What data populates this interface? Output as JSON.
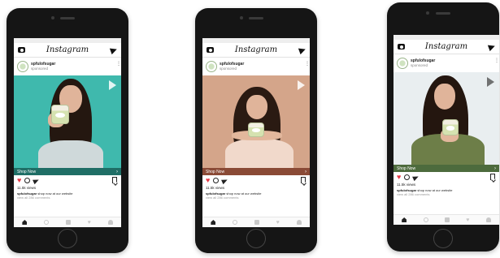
{
  "app": {
    "name": "Instagram"
  },
  "mockups": [
    {
      "user": "spfulofsugar",
      "sponsored": "sponsored",
      "cta": "Shop Now",
      "views": "11.5k views",
      "caption_user": "spfulofsugar",
      "caption_text": "shop now at our website",
      "view_comments": "view all 286 comments",
      "photo_bg": "#3fb9ad",
      "cta_bg": "#1f6e66"
    },
    {
      "user": "spfulofsugar",
      "sponsored": "sponsored",
      "cta": "Shop Now",
      "views": "11.5k views",
      "caption_user": "spfulofsugar",
      "caption_text": "shop now at our website",
      "view_comments": "view all 286 comments",
      "photo_bg": "#d4a58a",
      "cta_bg": "#8a4a36"
    },
    {
      "user": "spfulofsugar",
      "sponsored": "sponsored",
      "cta": "Shop Now",
      "views": "11.5k views",
      "caption_user": "spfulofsugar",
      "caption_text": "shop now at our website",
      "view_comments": "view all 286 comments",
      "photo_bg": "#e9eef0",
      "cta_bg": "#4d6b3d"
    }
  ],
  "icons": {
    "camera": "camera-icon",
    "send": "send-icon",
    "more": "more-icon",
    "play": "play-icon",
    "heart": "heart-icon",
    "comment": "comment-icon",
    "share": "share-icon",
    "bookmark": "bookmark-icon",
    "nav": [
      "home-icon",
      "search-icon",
      "add-post-icon",
      "activity-icon",
      "profile-icon"
    ]
  }
}
